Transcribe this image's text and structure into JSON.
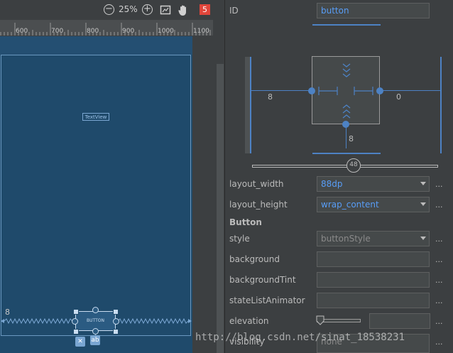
{
  "toolbar": {
    "zoom_out_icon": "minus-circle-icon",
    "zoom_level": "25%",
    "zoom_in_icon": "plus-circle-icon",
    "fit_icon": "fit-screen-icon",
    "pan_icon": "hand-icon",
    "issues_count": "5"
  },
  "ruler": {
    "ticks": [
      "600",
      "700",
      "800",
      "900",
      "1000",
      "1100"
    ]
  },
  "canvas": {
    "textview_label": "TextView",
    "button_label": "BUTTON",
    "margin_value": "8",
    "baseline_icon_label": "✕",
    "text_icon_label": "ab"
  },
  "properties": {
    "id_label": "ID",
    "id_value": "button",
    "constraint": {
      "left_margin": "8",
      "right_margin": "0",
      "bottom_margin": "8",
      "bias": "48"
    },
    "layout_width_label": "layout_width",
    "layout_width_value": "88dp",
    "layout_height_label": "layout_height",
    "layout_height_value": "wrap_content",
    "section_title": "Button",
    "style_label": "style",
    "style_value": "buttonStyle",
    "background_label": "background",
    "background_tint_label": "backgroundTint",
    "state_list_animator_label": "stateListAnimator",
    "elevation_label": "elevation",
    "visibility_label": "visibility",
    "visibility_value": "none",
    "more_label": "..."
  },
  "watermark": "http://blog.csdn.net/sinat_18538231"
}
